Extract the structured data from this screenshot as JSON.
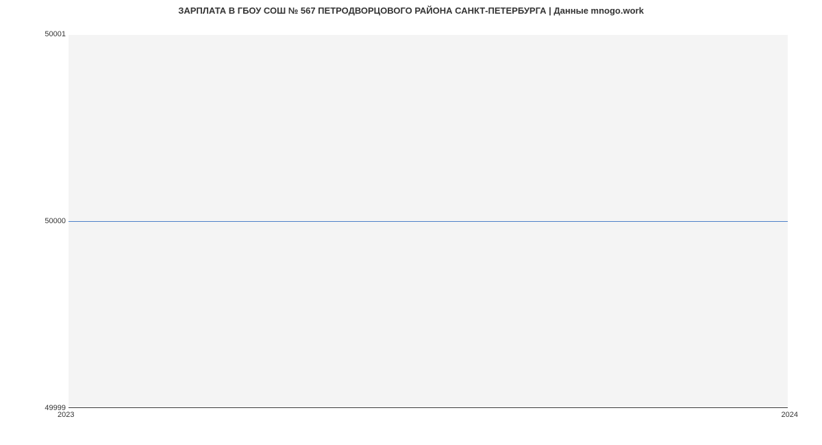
{
  "chart_data": {
    "type": "line",
    "title": "ЗАРПЛАТА В ГБОУ СОШ № 567 ПЕТРОДВОРЦОВОГО РАЙОНА САНКТ-ПЕТЕРБУРГА | Данные mnogo.work",
    "x": [
      2023,
      2024
    ],
    "values": [
      50000,
      50000
    ],
    "xlabel": "",
    "ylabel": "",
    "ylim": [
      49999,
      50001
    ],
    "xlim": [
      2023,
      2024
    ],
    "y_ticks": [
      49999,
      50000,
      50001
    ],
    "x_ticks": [
      2023,
      2024
    ],
    "line_color": "#4a7ec8"
  },
  "labels": {
    "y_top": "50001",
    "y_mid": "50000",
    "y_bot": "49999",
    "x_left": "2023",
    "x_right": "2024"
  }
}
